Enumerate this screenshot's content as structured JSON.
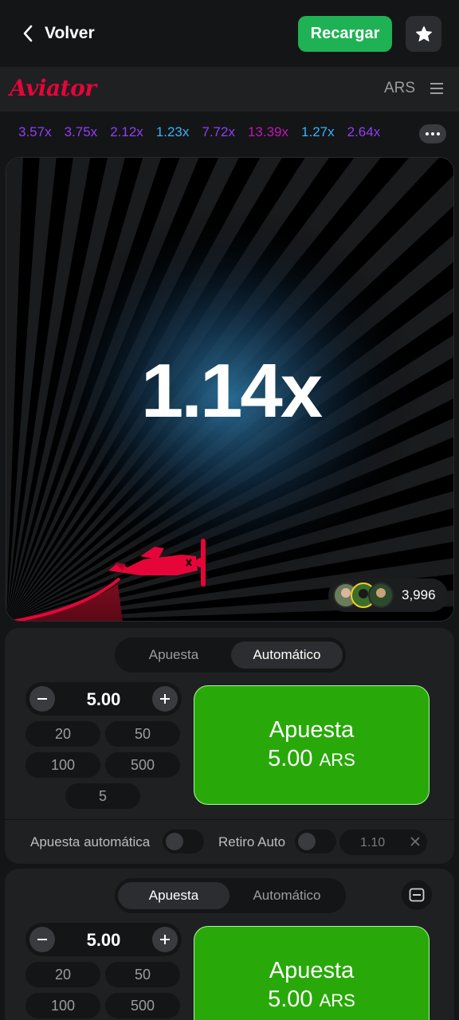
{
  "topbar": {
    "back_label": "Volver",
    "recharge_label": "Recargar",
    "recharge_color": "#1fb254"
  },
  "game_header": {
    "logo": "Aviator",
    "logo_color": "#e50539",
    "currency": "ARS"
  },
  "history": [
    {
      "value": "3.57x",
      "color": "#913ef8"
    },
    {
      "value": "3.75x",
      "color": "#913ef8"
    },
    {
      "value": "2.12x",
      "color": "#913ef8"
    },
    {
      "value": "1.23x",
      "color": "#34b4ff"
    },
    {
      "value": "7.72x",
      "color": "#913ef8"
    },
    {
      "value": "13.39x",
      "color": "#c017b4"
    },
    {
      "value": "1.27x",
      "color": "#34b4ff"
    },
    {
      "value": "2.64x",
      "color": "#913ef8"
    }
  ],
  "game": {
    "multiplier": "1.14x",
    "players_count": "3,996",
    "plane_color": "#e50539"
  },
  "bet_panel_1": {
    "tabs": [
      "Apuesta",
      "Automático"
    ],
    "active_tab": "Automático",
    "amount": "5.00",
    "chips": [
      "20",
      "50",
      "100",
      "500",
      "5"
    ],
    "bet_label": "Apuesta",
    "bet_amount": "5.00",
    "bet_currency": "ARS",
    "auto_bet_label": "Apuesta automática",
    "auto_cashout_label": "Retiro Auto",
    "auto_cashout_value": "1.10"
  },
  "bet_panel_2": {
    "tabs": [
      "Apuesta",
      "Automático"
    ],
    "active_tab": "Apuesta",
    "amount": "5.00",
    "chips": [
      "20",
      "50",
      "100",
      "500"
    ],
    "bet_label": "Apuesta",
    "bet_amount": "5.00",
    "bet_currency": "ARS"
  },
  "bet_button_color": "#28a909"
}
